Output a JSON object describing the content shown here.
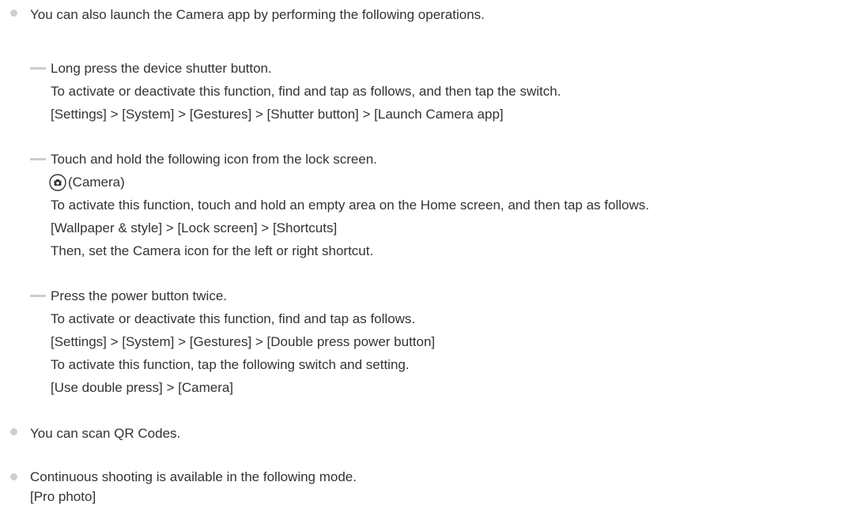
{
  "items": [
    {
      "text": "You can also launch the Camera app by performing the following operations."
    },
    {
      "text": "You can scan QR Codes."
    },
    {
      "text": "Continuous shooting is available in the following mode.",
      "line2": "[Pro photo]"
    }
  ],
  "sub": [
    {
      "head": "Long press the device shutter button.",
      "lines": [
        "To activate or deactivate this function, find and tap as follows, and then tap the switch.",
        "[Settings] > [System] > [Gestures] > [Shutter button] > [Launch Camera app]"
      ]
    },
    {
      "head": "Touch and hold the following icon from the lock screen.",
      "icon_label": "(Camera)",
      "icon_name": "camera-icon",
      "lines": [
        "To activate this function, touch and hold an empty area on the Home screen, and then tap as follows.",
        "[Wallpaper & style] > [Lock screen] > [Shortcuts]",
        "Then, set the Camera icon for the left or right shortcut."
      ]
    },
    {
      "head": "Press the power button twice.",
      "lines": [
        "To activate or deactivate this function, find and tap as follows.",
        "[Settings] > [System] > [Gestures] > [Double press power button]",
        "To activate this function, tap the following switch and setting.",
        "[Use double press] > [Camera]"
      ]
    }
  ],
  "colors": {
    "text": "#333333",
    "bullet": "#cfcfcf",
    "dash": "#cccccc"
  }
}
